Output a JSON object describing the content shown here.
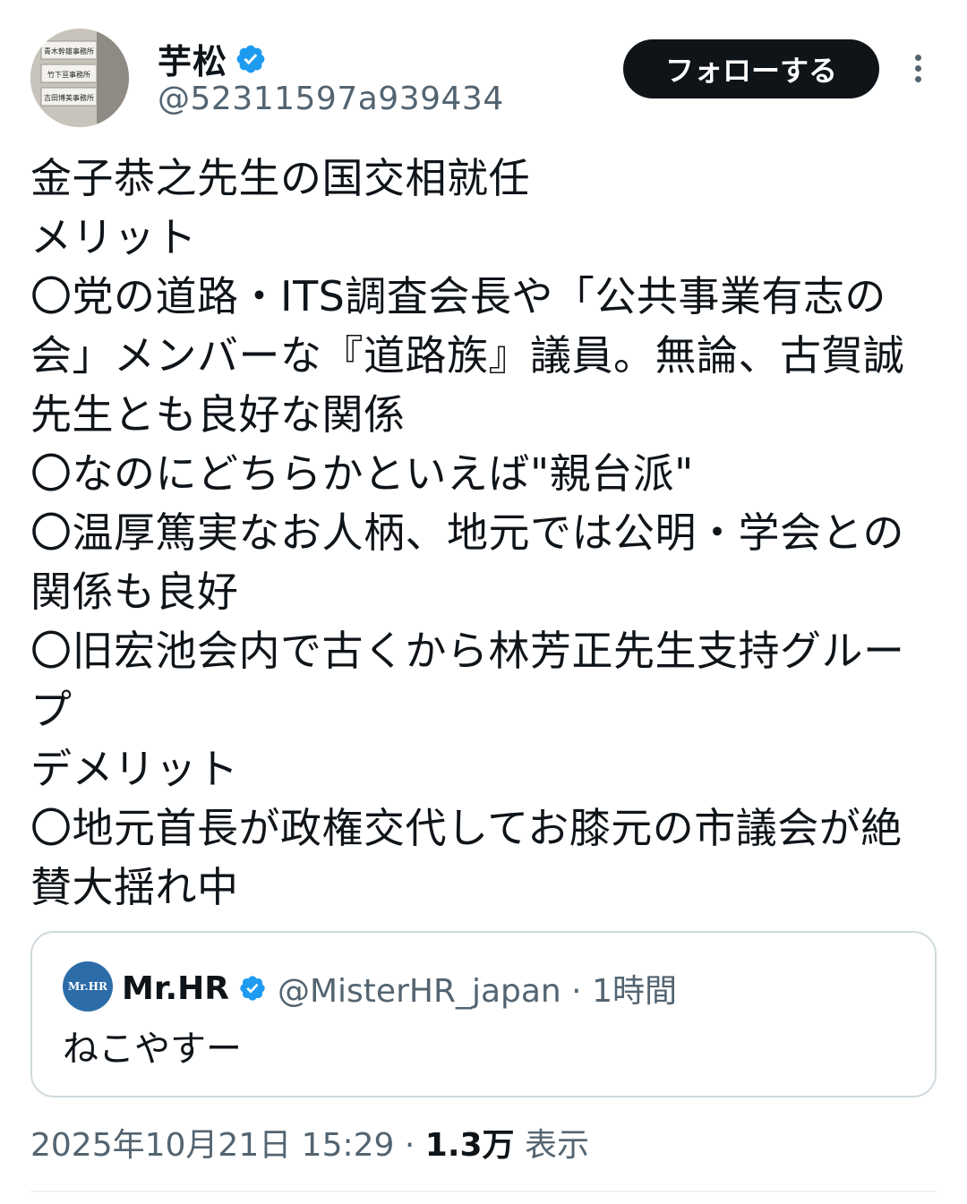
{
  "colors": {
    "text": "#0f1419",
    "secondary": "#536471",
    "verified": "#1d9bf0",
    "border": "#cfd9de"
  },
  "author": {
    "display_name": "芋松",
    "handle": "@52311597a939434",
    "verified": true,
    "avatar_signs": [
      "青木幹雄事務所",
      "竹下亘事務所",
      "吉田博美事務所"
    ]
  },
  "actions": {
    "follow_label": "フォローする",
    "more_icon": "more-vertical-icon"
  },
  "tweet": {
    "text": "金子恭之先生の国交相就任\nメリット\n〇党の道路・ITS調査会長や「公共事業有志の会」メンバーな『道路族』議員。無論、古賀誠先生とも良好な関係\n〇なのにどちらかといえば\"親台派\"\n〇温厚篤実なお人柄、地元では公明・学会との関係も良好\n〇旧宏池会内で古くから林芳正先生支持グループ\nデメリット\n〇地元首長が政権交代してお膝元の市議会が絶賛大揺れ中"
  },
  "quote": {
    "avatar_text": "Mr.HR",
    "name": "Mr.HR",
    "verified": true,
    "meta": "@MisterHR_japan · 1時間",
    "text": "ねこやすー"
  },
  "footer": {
    "datetime": "2025年10月21日 15:29 · ",
    "views_count": "1.3万",
    "views_label": " 表示"
  }
}
